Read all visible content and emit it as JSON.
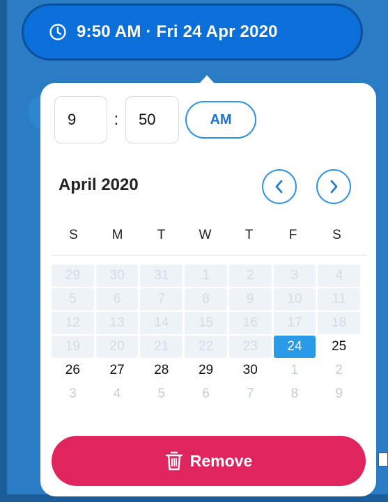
{
  "colors": {
    "background": "#2a7dc4",
    "pill": "#0a6fd8",
    "accent": "#2a90e8",
    "selected": "#2a9be9",
    "danger": "#e0245e"
  },
  "time_pill": {
    "icon": "clock-icon",
    "label": "9:50 AM · Fri 24 Apr 2020"
  },
  "picker": {
    "hour": "9",
    "separator": ":",
    "minute": "50",
    "ampm": "AM"
  },
  "calendar": {
    "month_title": "April 2020",
    "prev_icon": "chevron-left-icon",
    "next_icon": "chevron-right-icon",
    "weekdays": [
      "S",
      "M",
      "T",
      "W",
      "T",
      "F",
      "S"
    ],
    "weeks": [
      [
        {
          "d": "29",
          "s": "disabled"
        },
        {
          "d": "30",
          "s": "disabled"
        },
        {
          "d": "31",
          "s": "disabled"
        },
        {
          "d": "1",
          "s": "disabled"
        },
        {
          "d": "2",
          "s": "disabled"
        },
        {
          "d": "3",
          "s": "disabled"
        },
        {
          "d": "4",
          "s": "disabled"
        }
      ],
      [
        {
          "d": "5",
          "s": "disabled"
        },
        {
          "d": "6",
          "s": "disabled"
        },
        {
          "d": "7",
          "s": "disabled"
        },
        {
          "d": "8",
          "s": "disabled"
        },
        {
          "d": "9",
          "s": "disabled"
        },
        {
          "d": "10",
          "s": "disabled"
        },
        {
          "d": "11",
          "s": "disabled"
        }
      ],
      [
        {
          "d": "12",
          "s": "disabled"
        },
        {
          "d": "13",
          "s": "disabled"
        },
        {
          "d": "14",
          "s": "disabled"
        },
        {
          "d": "15",
          "s": "disabled"
        },
        {
          "d": "16",
          "s": "disabled"
        },
        {
          "d": "17",
          "s": "disabled"
        },
        {
          "d": "18",
          "s": "disabled"
        }
      ],
      [
        {
          "d": "19",
          "s": "disabled"
        },
        {
          "d": "20",
          "s": "disabled"
        },
        {
          "d": "21",
          "s": "disabled"
        },
        {
          "d": "22",
          "s": "disabled"
        },
        {
          "d": "23",
          "s": "disabled"
        },
        {
          "d": "24",
          "s": "selected"
        },
        {
          "d": "25",
          "s": "normal"
        }
      ],
      [
        {
          "d": "26",
          "s": "normal"
        },
        {
          "d": "27",
          "s": "normal"
        },
        {
          "d": "28",
          "s": "normal"
        },
        {
          "d": "29",
          "s": "normal"
        },
        {
          "d": "30",
          "s": "normal"
        },
        {
          "d": "1",
          "s": "faded"
        },
        {
          "d": "2",
          "s": "faded"
        }
      ],
      [
        {
          "d": "3",
          "s": "faded"
        },
        {
          "d": "4",
          "s": "faded"
        },
        {
          "d": "5",
          "s": "faded"
        },
        {
          "d": "6",
          "s": "faded"
        },
        {
          "d": "7",
          "s": "faded"
        },
        {
          "d": "8",
          "s": "faded"
        },
        {
          "d": "9",
          "s": "faded"
        }
      ]
    ]
  },
  "remove_button": {
    "icon": "trash-icon",
    "label": "Remove"
  }
}
